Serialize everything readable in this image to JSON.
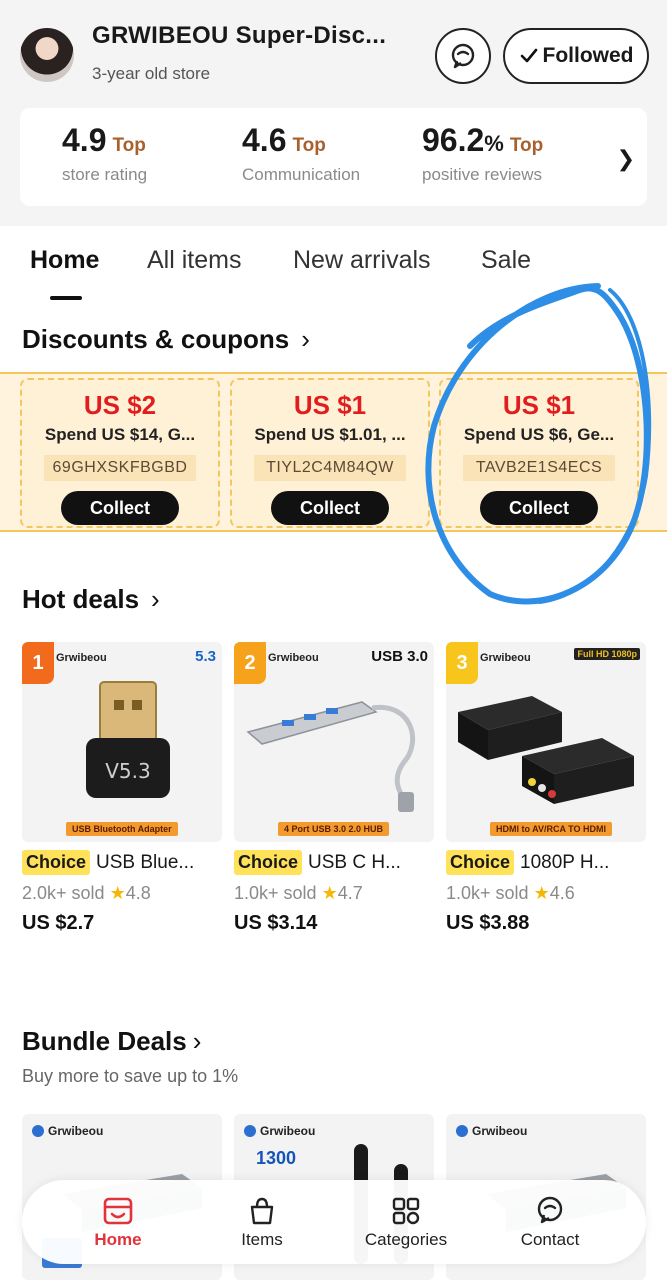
{
  "store": {
    "name": "GRWIBEOU Super-Disc...",
    "age": "3-year old store",
    "follow_label": "Followed"
  },
  "stats": [
    {
      "value": "4.9",
      "unit": "",
      "tag": "Top",
      "label": "store rating"
    },
    {
      "value": "4.6",
      "unit": "",
      "tag": "Top",
      "label": "Communication"
    },
    {
      "value": "96.2",
      "unit": "%",
      "tag": "Top",
      "label": "positive reviews"
    }
  ],
  "tabs": [
    "Home",
    "All items",
    "New arrivals",
    "Sale"
  ],
  "sections": {
    "coupons_title": "Discounts & coupons",
    "hot_deals_title": "Hot deals",
    "bundle_title": "Bundle Deals",
    "bundle_subtitle": "Buy more to save up to  1%"
  },
  "coupons": [
    {
      "amount": "US $2",
      "condition": "Spend US $14, G...",
      "code": "69GHXSKFBGBD",
      "button": "Collect"
    },
    {
      "amount": "US $1",
      "condition": "Spend US $1.01, ...",
      "code": "TIYL2C4M84QW",
      "button": "Collect"
    },
    {
      "amount": "US $1",
      "condition": "Spend US $6, Ge...",
      "code": "TAVB2E1S4ECS",
      "button": "Collect"
    }
  ],
  "deals": [
    {
      "rank": "1",
      "rank_color": "#f26b1d",
      "brand": "Grwibeou",
      "corner": "5.3",
      "banner": "USB Bluetooth Adapter",
      "badge": "Choice",
      "title": "USB Blue...",
      "sold": "2.0k+ sold",
      "rating": "4.8",
      "price": "US $2.7"
    },
    {
      "rank": "2",
      "rank_color": "#f7a21b",
      "brand": "Grwibeou",
      "corner": "USB 3.0",
      "banner": "4 Port USB 3.0 2.0 HUB",
      "badge": "Choice",
      "title": "USB C H...",
      "sold": "1.0k+ sold",
      "rating": "4.7",
      "price": "US $3.14"
    },
    {
      "rank": "3",
      "rank_color": "#f7c51b",
      "brand": "Grwibeou",
      "corner": "Full HD 1080p",
      "banner": "HDMI to AV/RCA TO HDMI",
      "badge": "Choice",
      "title": "1080P H...",
      "sold": "1.0k+ sold",
      "rating": "4.6",
      "price": "US $3.88"
    }
  ],
  "bundles": [
    {
      "brand": "Grwibeou",
      "extra": ""
    },
    {
      "brand": "Grwibeou",
      "extra": "1300"
    },
    {
      "brand": "Grwibeou",
      "extra": ""
    }
  ],
  "nav": [
    "Home",
    "Items",
    "Categories",
    "Contact"
  ],
  "colors": {
    "accent": "#e0343a",
    "coupon_red": "#e21d1d",
    "annotation": "#2e8ee6",
    "choice_yellow": "#ffe15a"
  }
}
